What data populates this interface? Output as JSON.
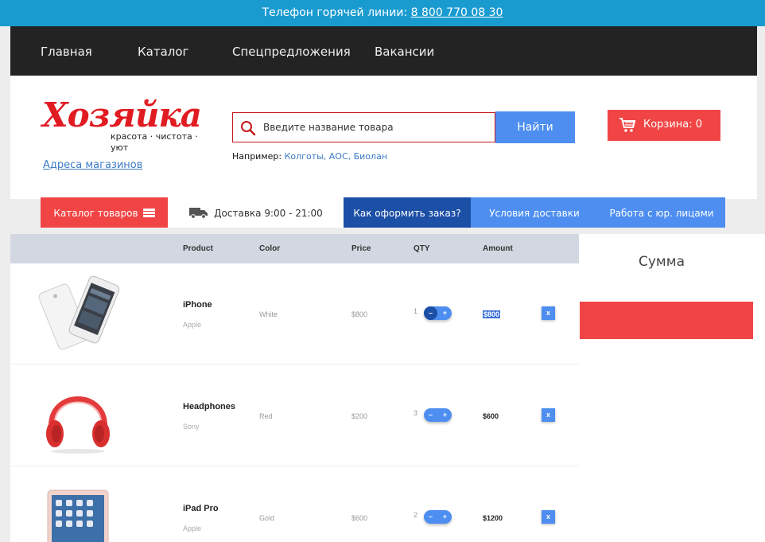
{
  "hotline": {
    "label": "Телефон горячей линии:",
    "phone": "8 800 770 08 30"
  },
  "topnav": [
    "Главная",
    "Каталог",
    "Спецпредложения",
    "Вакансии"
  ],
  "logo": {
    "title": "Хозяйка",
    "subtitle": "красота · чистота · уют"
  },
  "stores_link": "Адреса магазинов",
  "search": {
    "placeholder": "Введите название товара",
    "button": "Найти",
    "example_label": "Например:",
    "example_links": "Колготы, АОС, Биолан"
  },
  "cart_button": "Корзина: 0",
  "infobar": {
    "catalog": "Каталог товаров",
    "delivery": "Доставка 9:00 - 21:00",
    "order": "Как оформить заказ?",
    "conditions": "Условия доставки",
    "legal": "Работа с юр. лицами"
  },
  "table": {
    "headers": {
      "product": "Product",
      "color": "Color",
      "price": "Price",
      "qty": "QTY",
      "amount": "Amount"
    },
    "rows": [
      {
        "name": "iPhone",
        "brand": "Apple",
        "color": "White",
        "price": "$800",
        "qty": "1",
        "amount": "$800"
      },
      {
        "name": "Headphones",
        "brand": "Sony",
        "color": "Red",
        "price": "$200",
        "qty": "3",
        "amount": "$600"
      },
      {
        "name": "iPad Pro",
        "brand": "Apple",
        "color": "Gold",
        "price": "$600",
        "qty": "2",
        "amount": "$1200"
      }
    ],
    "minus": "–",
    "plus": "+",
    "remove": "x"
  },
  "summary": {
    "title": "Сумма"
  },
  "colors": {
    "hotline": "#1a9bd0",
    "nav": "#232323",
    "accent_red": "#f14545",
    "accent_blue": "#4d8ef0",
    "dark_blue": "#1c4fa6",
    "logo_red": "#e11b22"
  }
}
